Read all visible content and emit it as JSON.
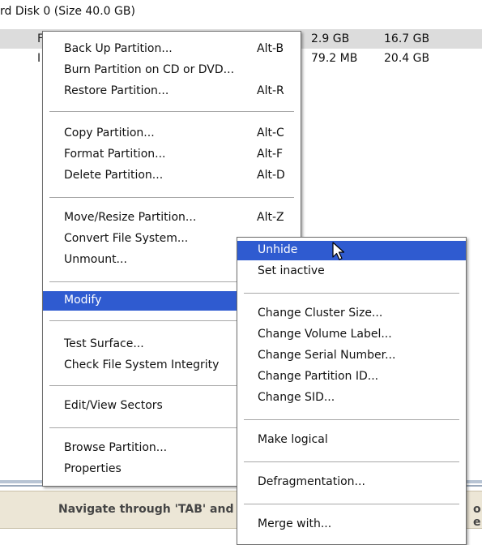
{
  "disk_header": "rd Disk 0 (Size 40.0 GB)",
  "table": {
    "rows": [
      {
        "prefix": "F",
        "used": "2.9 GB",
        "unused": "16.7 GB"
      },
      {
        "prefix": "I",
        "used": "79.2 MB",
        "unused": "20.4 GB"
      }
    ]
  },
  "context_menu": {
    "groups": [
      [
        {
          "label": "Back Up Partition...",
          "shortcut": "Alt-B"
        },
        {
          "label": "Burn Partition on CD or DVD...",
          "shortcut": ""
        },
        {
          "label": "Restore Partition...",
          "shortcut": "Alt-R"
        }
      ],
      [
        {
          "label": "Copy Partition...",
          "shortcut": "Alt-C"
        },
        {
          "label": "Format Partition...",
          "shortcut": "Alt-F"
        },
        {
          "label": "Delete Partition...",
          "shortcut": "Alt-D"
        }
      ],
      [
        {
          "label": "Move/Resize Partition...",
          "shortcut": "Alt-Z"
        },
        {
          "label": "Convert File System...",
          "shortcut": ""
        },
        {
          "label": "Unmount...",
          "shortcut": ""
        }
      ],
      [
        {
          "label": "Modify",
          "shortcut": ""
        }
      ],
      [
        {
          "label": "Test Surface...",
          "shortcut": ""
        },
        {
          "label": "Check File System Integrity",
          "shortcut": ""
        }
      ],
      [
        {
          "label": "Edit/View Sectors",
          "shortcut": ""
        }
      ],
      [
        {
          "label": "Browse Partition...",
          "shortcut": ""
        },
        {
          "label": "Properties",
          "shortcut": ""
        }
      ]
    ]
  },
  "submenu": {
    "groups": [
      [
        {
          "label": "Unhide"
        },
        {
          "label": "Set inactive"
        }
      ],
      [
        {
          "label": "Change Cluster Size..."
        },
        {
          "label": "Change Volume Label..."
        },
        {
          "label": "Change Serial Number..."
        },
        {
          "label": "Change Partition ID..."
        },
        {
          "label": "Change SID..."
        }
      ],
      [
        {
          "label": "Make logical"
        }
      ],
      [
        {
          "label": "Defragmentation..."
        }
      ],
      [
        {
          "label": "Merge with..."
        }
      ]
    ]
  },
  "status_bar": {
    "text": "Navigate through 'TAB' and '",
    "right_fragment": "o e"
  },
  "colors": {
    "highlight": "#2f5bd0",
    "status_bg": "#ece6d6"
  },
  "icons": {
    "cursor": "mouse-pointer-icon"
  }
}
